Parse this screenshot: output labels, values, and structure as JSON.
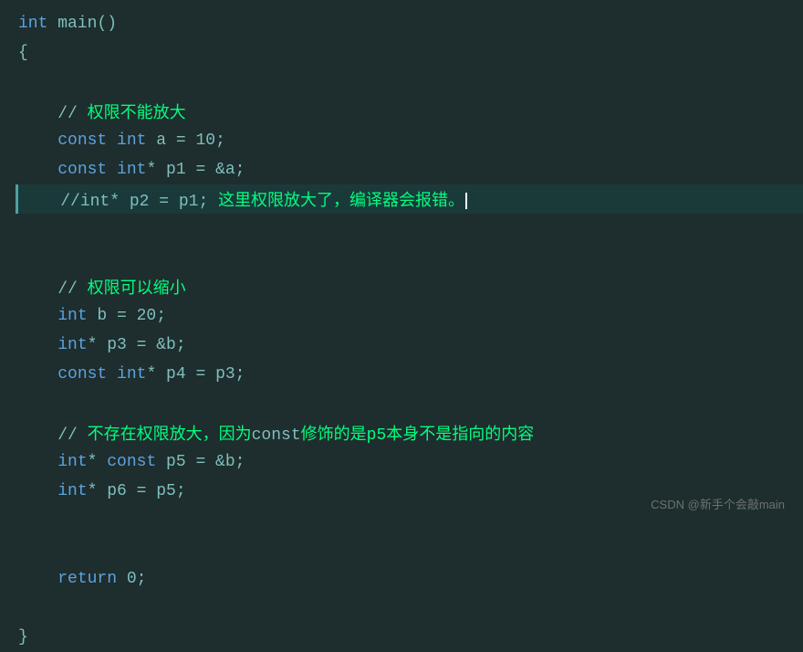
{
  "code": {
    "lines": [
      {
        "id": "line1",
        "parts": [
          {
            "type": "kw",
            "text": "int"
          },
          {
            "type": "plain",
            "text": " main()"
          }
        ],
        "highlighted": false
      },
      {
        "id": "line2",
        "parts": [
          {
            "type": "plain",
            "text": "{"
          }
        ],
        "highlighted": false
      },
      {
        "id": "line3",
        "parts": [],
        "highlighted": false
      },
      {
        "id": "line4",
        "parts": [
          {
            "type": "plain",
            "text": "    "
          },
          {
            "type": "comment-sym",
            "text": "// "
          },
          {
            "type": "comment-text",
            "text": "权限不能放大"
          }
        ],
        "highlighted": false
      },
      {
        "id": "line5",
        "parts": [
          {
            "type": "plain",
            "text": "    "
          },
          {
            "type": "kw",
            "text": "const"
          },
          {
            "type": "plain",
            "text": " "
          },
          {
            "type": "kw",
            "text": "int"
          },
          {
            "type": "plain",
            "text": " a = 10;"
          }
        ],
        "highlighted": false
      },
      {
        "id": "line6",
        "parts": [
          {
            "type": "plain",
            "text": "    "
          },
          {
            "type": "kw",
            "text": "const"
          },
          {
            "type": "plain",
            "text": " "
          },
          {
            "type": "kw",
            "text": "int"
          },
          {
            "type": "plain",
            "text": "* p1 = &a;"
          }
        ],
        "highlighted": false
      },
      {
        "id": "line7",
        "parts": [
          {
            "type": "plain",
            "text": "    "
          },
          {
            "type": "comment-sym",
            "text": "//"
          },
          {
            "type": "plain",
            "text": "int* p2 = p1; "
          },
          {
            "type": "comment-text",
            "text": "这里权限放大了，编译器会报错。"
          },
          {
            "type": "cursor",
            "text": ""
          }
        ],
        "highlighted": true
      },
      {
        "id": "line8",
        "parts": [],
        "highlighted": false
      },
      {
        "id": "line9",
        "parts": [],
        "highlighted": false
      },
      {
        "id": "line10",
        "parts": [
          {
            "type": "plain",
            "text": "    "
          },
          {
            "type": "comment-sym",
            "text": "// "
          },
          {
            "type": "comment-text",
            "text": "权限可以缩小"
          }
        ],
        "highlighted": false
      },
      {
        "id": "line11",
        "parts": [
          {
            "type": "plain",
            "text": "    "
          },
          {
            "type": "kw",
            "text": "int"
          },
          {
            "type": "plain",
            "text": " b = 20;"
          }
        ],
        "highlighted": false
      },
      {
        "id": "line12",
        "parts": [
          {
            "type": "plain",
            "text": "    "
          },
          {
            "type": "kw",
            "text": "int"
          },
          {
            "type": "plain",
            "text": "* p3 = &b;"
          }
        ],
        "highlighted": false
      },
      {
        "id": "line13",
        "parts": [
          {
            "type": "plain",
            "text": "    "
          },
          {
            "type": "kw",
            "text": "const"
          },
          {
            "type": "plain",
            "text": " "
          },
          {
            "type": "kw",
            "text": "int"
          },
          {
            "type": "plain",
            "text": "* p4 = p3;"
          }
        ],
        "highlighted": false
      },
      {
        "id": "line14",
        "parts": [],
        "highlighted": false
      },
      {
        "id": "line15",
        "parts": [
          {
            "type": "plain",
            "text": "    "
          },
          {
            "type": "comment-sym",
            "text": "// "
          },
          {
            "type": "comment-text",
            "text": "不存在权限放大，因为"
          },
          {
            "type": "plain",
            "text": "const"
          },
          {
            "type": "comment-text",
            "text": "修饰的是p5本身不是指向的内容"
          }
        ],
        "highlighted": false
      },
      {
        "id": "line16",
        "parts": [
          {
            "type": "plain",
            "text": "    "
          },
          {
            "type": "kw",
            "text": "int"
          },
          {
            "type": "plain",
            "text": "* "
          },
          {
            "type": "kw",
            "text": "const"
          },
          {
            "type": "plain",
            "text": " p5 = &b;"
          }
        ],
        "highlighted": false
      },
      {
        "id": "line17",
        "parts": [
          {
            "type": "plain",
            "text": "    "
          },
          {
            "type": "kw",
            "text": "int"
          },
          {
            "type": "plain",
            "text": "* p6 = p5;"
          }
        ],
        "highlighted": false
      },
      {
        "id": "line18",
        "parts": [],
        "highlighted": false
      },
      {
        "id": "line19",
        "parts": [],
        "highlighted": false
      },
      {
        "id": "line20",
        "parts": [
          {
            "type": "plain",
            "text": "    "
          },
          {
            "type": "kw",
            "text": "return"
          },
          {
            "type": "plain",
            "text": " 0;"
          }
        ],
        "highlighted": false
      },
      {
        "id": "line21",
        "parts": [],
        "highlighted": false
      },
      {
        "id": "line22",
        "parts": [
          {
            "type": "plain",
            "text": "}"
          }
        ],
        "highlighted": false
      }
    ]
  },
  "watermark": {
    "text": "CSDN @新手个会敲main"
  }
}
